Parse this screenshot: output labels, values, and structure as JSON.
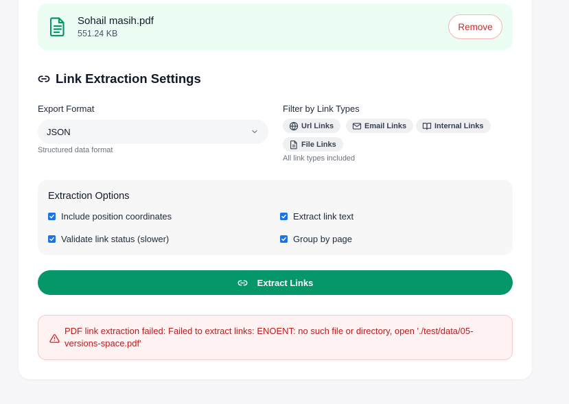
{
  "file": {
    "name": "Sohail masih.pdf",
    "size": "551.24 KB",
    "remove_label": "Remove"
  },
  "settings": {
    "title": "Link Extraction Settings",
    "export_format": {
      "label": "Export Format",
      "value": "JSON",
      "hint": "Structured data format"
    },
    "filter": {
      "label": "Filter by Link Types",
      "chips": [
        {
          "label": "Url Links",
          "icon": "globe-icon"
        },
        {
          "label": "Email Links",
          "icon": "mail-icon"
        },
        {
          "label": "Internal Links",
          "icon": "book-icon"
        },
        {
          "label": "File Links",
          "icon": "file-icon"
        }
      ],
      "hint": "All link types included"
    }
  },
  "options": {
    "title": "Extraction Options",
    "items": [
      {
        "label": "Include position coordinates",
        "checked": true
      },
      {
        "label": "Extract link text",
        "checked": true
      },
      {
        "label": "Validate link status (slower)",
        "checked": true
      },
      {
        "label": "Group by page",
        "checked": true
      }
    ]
  },
  "action": {
    "extract_label": "Extract Links"
  },
  "error": {
    "message": "PDF link extraction failed: Failed to extract links: ENOENT: no such file or directory, open './test/data/05-versions-space.pdf'"
  },
  "colors": {
    "primary": "#059669",
    "file_bg": "#ecfdf3",
    "danger": "#dc2626",
    "error_bg": "#fef2f2",
    "checkbox": "#1a73e8"
  }
}
